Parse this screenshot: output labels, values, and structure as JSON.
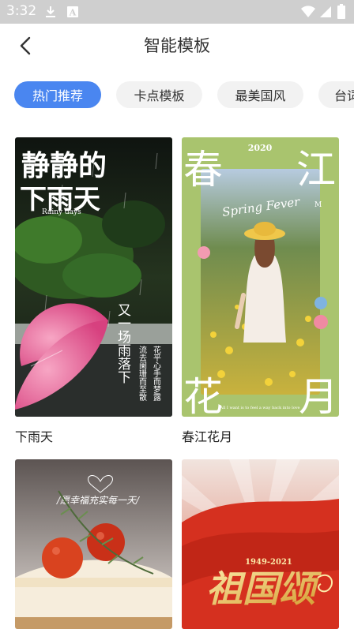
{
  "status_bar": {
    "time": "3:32",
    "notif_badge": "A"
  },
  "header": {
    "title": "智能模板"
  },
  "tabs": [
    {
      "label": "热门推荐",
      "active": true
    },
    {
      "label": "卡点模板",
      "active": false
    },
    {
      "label": "最美国风",
      "active": false
    },
    {
      "label": "台词",
      "active": false
    }
  ],
  "templates": [
    {
      "name": "下雨天",
      "art": {
        "title_line1": "静静的",
        "title_line2": "下雨天",
        "subtitle": "Rainy days",
        "poem_col1": "又一场雨落下",
        "poem_col2": "流去阑珊而至散",
        "poem_col3": "花平心手而梦露"
      }
    },
    {
      "name": "春江花月",
      "art": {
        "year": "2020",
        "corner_tl": "春",
        "corner_tr": "江",
        "corner_bl": "花",
        "corner_br": "月",
        "script": "Spring Fever",
        "footnote": "All I want is to feel a way back into love",
        "brand": "M"
      }
    },
    {
      "name": "",
      "art": {
        "caption": "/愿幸福充实每一天/"
      }
    },
    {
      "name": "",
      "art": {
        "years": "1949-2021",
        "calligraphy": "祖国颂"
      }
    }
  ],
  "colors": {
    "accent": "#4a86f0",
    "tab_bg": "#f2f2f2",
    "frame_green": "#a9c46e"
  }
}
